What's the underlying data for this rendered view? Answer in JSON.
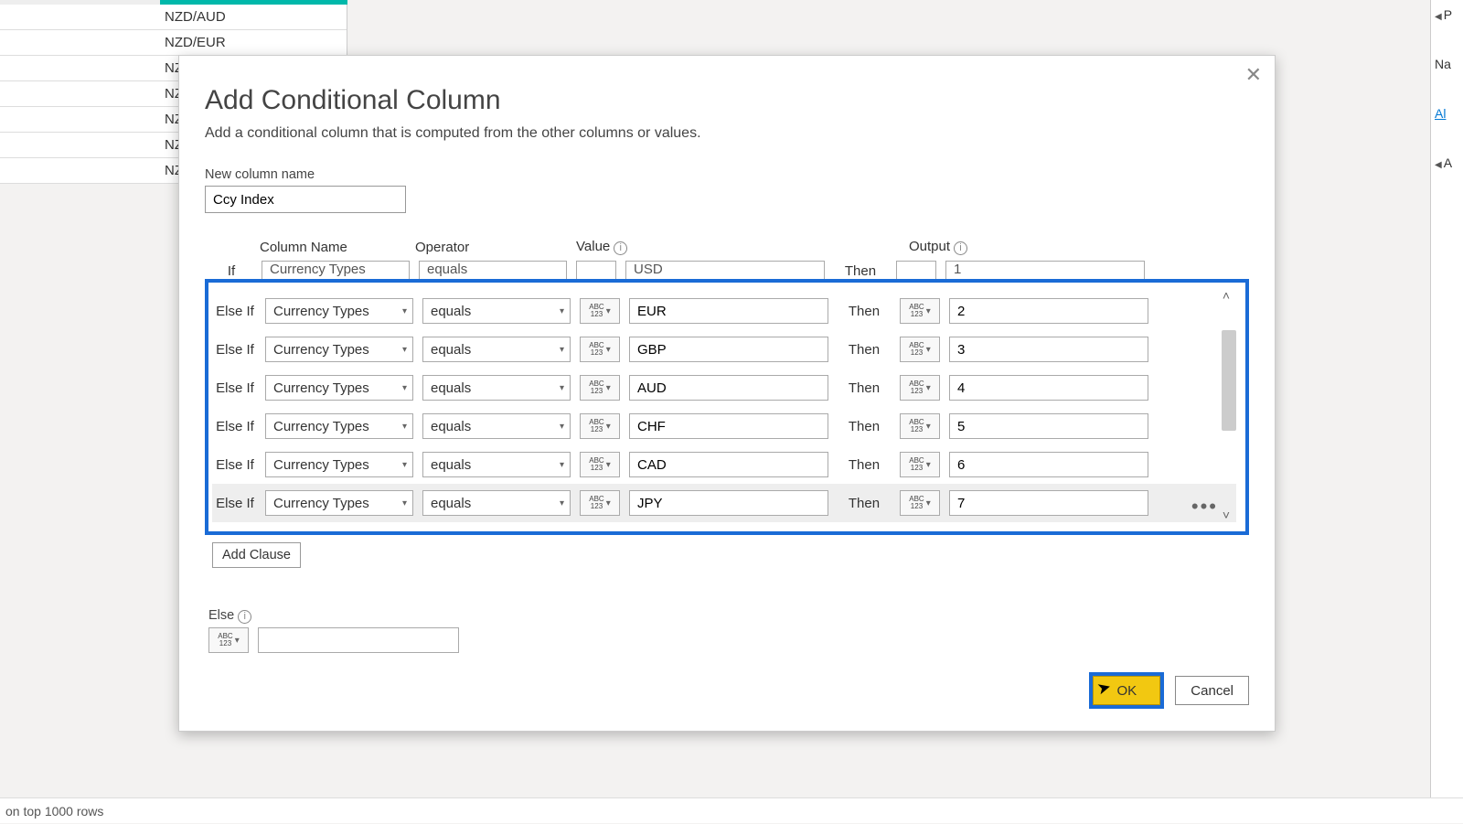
{
  "background": {
    "column_values": [
      "NZD/AUD",
      "NZD/EUR",
      "NZ",
      "NZ",
      "NZ",
      "NZ",
      "NZ"
    ]
  },
  "right_panel": {
    "items": [
      "P",
      "Na",
      "Al",
      "A"
    ]
  },
  "status_bar": {
    "text": "on top 1000 rows"
  },
  "dialog": {
    "title": "Add Conditional Column",
    "subtitle": "Add a conditional column that is computed from the other columns or values.",
    "new_col_label": "New column name",
    "new_col_value": "Ccy Index",
    "headers": {
      "col": "Column Name",
      "op": "Operator",
      "val": "Value",
      "out": "Output"
    },
    "top_stub": {
      "if": "If",
      "col": "Currency Types",
      "op": "equals",
      "val": "USD",
      "then": "Then",
      "out": "1"
    },
    "rules": [
      {
        "label": "Else If",
        "col": "Currency Types",
        "op": "equals",
        "val": "EUR",
        "then": "Then",
        "out": "2"
      },
      {
        "label": "Else If",
        "col": "Currency Types",
        "op": "equals",
        "val": "GBP",
        "then": "Then",
        "out": "3"
      },
      {
        "label": "Else If",
        "col": "Currency Types",
        "op": "equals",
        "val": "AUD",
        "then": "Then",
        "out": "4"
      },
      {
        "label": "Else If",
        "col": "Currency Types",
        "op": "equals",
        "val": "CHF",
        "then": "Then",
        "out": "5"
      },
      {
        "label": "Else If",
        "col": "Currency Types",
        "op": "equals",
        "val": "CAD",
        "then": "Then",
        "out": "6"
      },
      {
        "label": "Else If",
        "col": "Currency Types",
        "op": "equals",
        "val": "JPY",
        "then": "Then",
        "out": "7"
      }
    ],
    "add_clause": "Add Clause",
    "else_label": "Else",
    "else_value": "",
    "ok": "OK",
    "cancel": "Cancel"
  },
  "abc123": "ABC\n123"
}
